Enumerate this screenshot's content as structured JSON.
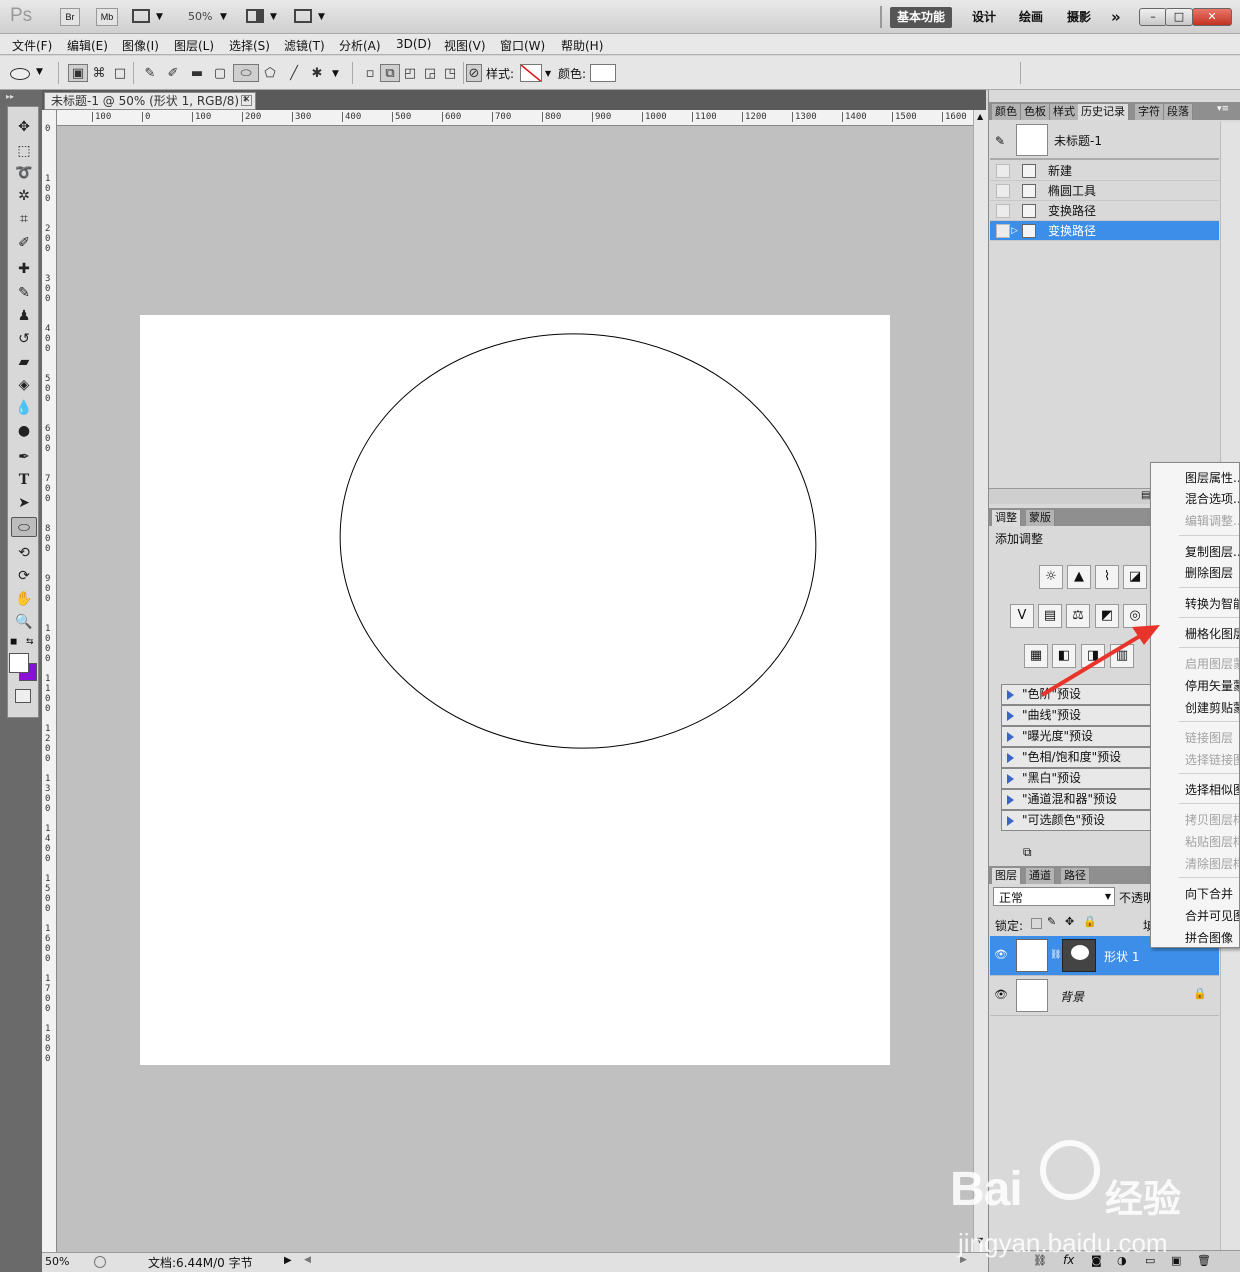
{
  "app": {
    "logo": "Ps",
    "br_label": "Br",
    "mb_label": "Mb",
    "zoom_select": "50%",
    "workspaces": [
      "基本功能",
      "设计",
      "绘画",
      "摄影"
    ],
    "more_symbol": "»"
  },
  "menu": [
    "文件(F)",
    "编辑(E)",
    "图像(I)",
    "图层(L)",
    "选择(S)",
    "滤镜(T)",
    "分析(A)",
    "3D(D)",
    "视图(V)",
    "窗口(W)",
    "帮助(H)"
  ],
  "options": {
    "style_label": "样式:",
    "color_label": "颜色:"
  },
  "document": {
    "tab_title": "未标题-1 @ 50% (形状 1, RGB/8) *",
    "zoom": "50%",
    "status": "文档:6.44M/0 字节",
    "hruler_labels": [
      "100",
      "0",
      "100",
      "200",
      "300",
      "400",
      "500",
      "600",
      "700",
      "800",
      "900",
      "1000",
      "1100",
      "1200",
      "1300",
      "1400",
      "1500",
      "1600"
    ],
    "vruler_labels": [
      "0",
      "1\n0\n0",
      "2\n0\n0",
      "3\n0\n0",
      "4\n0\n0",
      "5\n0\n0",
      "6\n0\n0",
      "7\n0\n0",
      "8\n0\n0",
      "9\n0\n0",
      "1\n0\n0\n0",
      "1\n1\n0\n0",
      "1\n2\n0\n0",
      "1\n3\n0\n0",
      "1\n4\n0\n0",
      "1\n5\n0\n0",
      "1\n6\n0\n0",
      "1\n7\n0\n0",
      "1\n8\n0\n0"
    ]
  },
  "history_panel": {
    "tabs": [
      "颜色",
      "色板",
      "样式",
      "历史记录",
      "字符",
      "段落"
    ],
    "snapshot_name": "未标题-1",
    "steps": [
      "新建",
      "椭圆工具",
      "变换路径",
      "变换路径"
    ]
  },
  "adjust_panel": {
    "tabs": [
      "调整",
      "蒙版"
    ],
    "title": "添加调整",
    "presets": [
      "\"色阶\"预设",
      "\"曲线\"预设",
      "\"曝光度\"预设",
      "\"色相/饱和度\"预设",
      "\"黑白\"预设",
      "\"通道混和器\"预设",
      "\"可选颜色\"预设"
    ]
  },
  "layers_panel": {
    "tabs": [
      "图层",
      "通道",
      "路径"
    ],
    "blend_mode": "正常",
    "opacity_label": "不透明",
    "lock_label": "锁定:",
    "fill_label": "填",
    "layers": [
      {
        "name": "形状 1",
        "selected": true
      },
      {
        "name": "背景",
        "selected": false
      }
    ]
  },
  "context_menu": {
    "items": [
      {
        "label": "图层属性...",
        "enabled": true
      },
      {
        "label": "混合选项...",
        "enabled": true
      },
      {
        "label": "编辑调整...",
        "enabled": false
      },
      {
        "label": "复制图层...",
        "enabled": true
      },
      {
        "label": "删除图层",
        "enabled": true
      },
      {
        "label": "转换为智能",
        "enabled": true
      },
      {
        "label": "栅格化图层",
        "enabled": true
      },
      {
        "label": "启用图层蒙",
        "enabled": false
      },
      {
        "label": "停用矢量蒙",
        "enabled": true
      },
      {
        "label": "创建剪贴蒙",
        "enabled": true
      },
      {
        "label": "链接图层",
        "enabled": false
      },
      {
        "label": "选择链接图",
        "enabled": false
      },
      {
        "label": "选择相似图",
        "enabled": true
      },
      {
        "label": "拷贝图层样",
        "enabled": false
      },
      {
        "label": "粘贴图层样",
        "enabled": false
      },
      {
        "label": "清除图层样",
        "enabled": false
      },
      {
        "label": "向下合并",
        "enabled": true
      },
      {
        "label": "合并可见图",
        "enabled": true
      },
      {
        "label": "拼合图像",
        "enabled": true
      }
    ]
  },
  "watermark": {
    "brand": "Bai",
    "brand2": "经验",
    "url": "jingyan.baidu.com"
  },
  "colors": {
    "selection_blue": "#3d8ee8",
    "canvas_bg": "#c0c0c0",
    "annotation_arrow": "#e8342a",
    "background_swatch": "#8a10d8"
  }
}
